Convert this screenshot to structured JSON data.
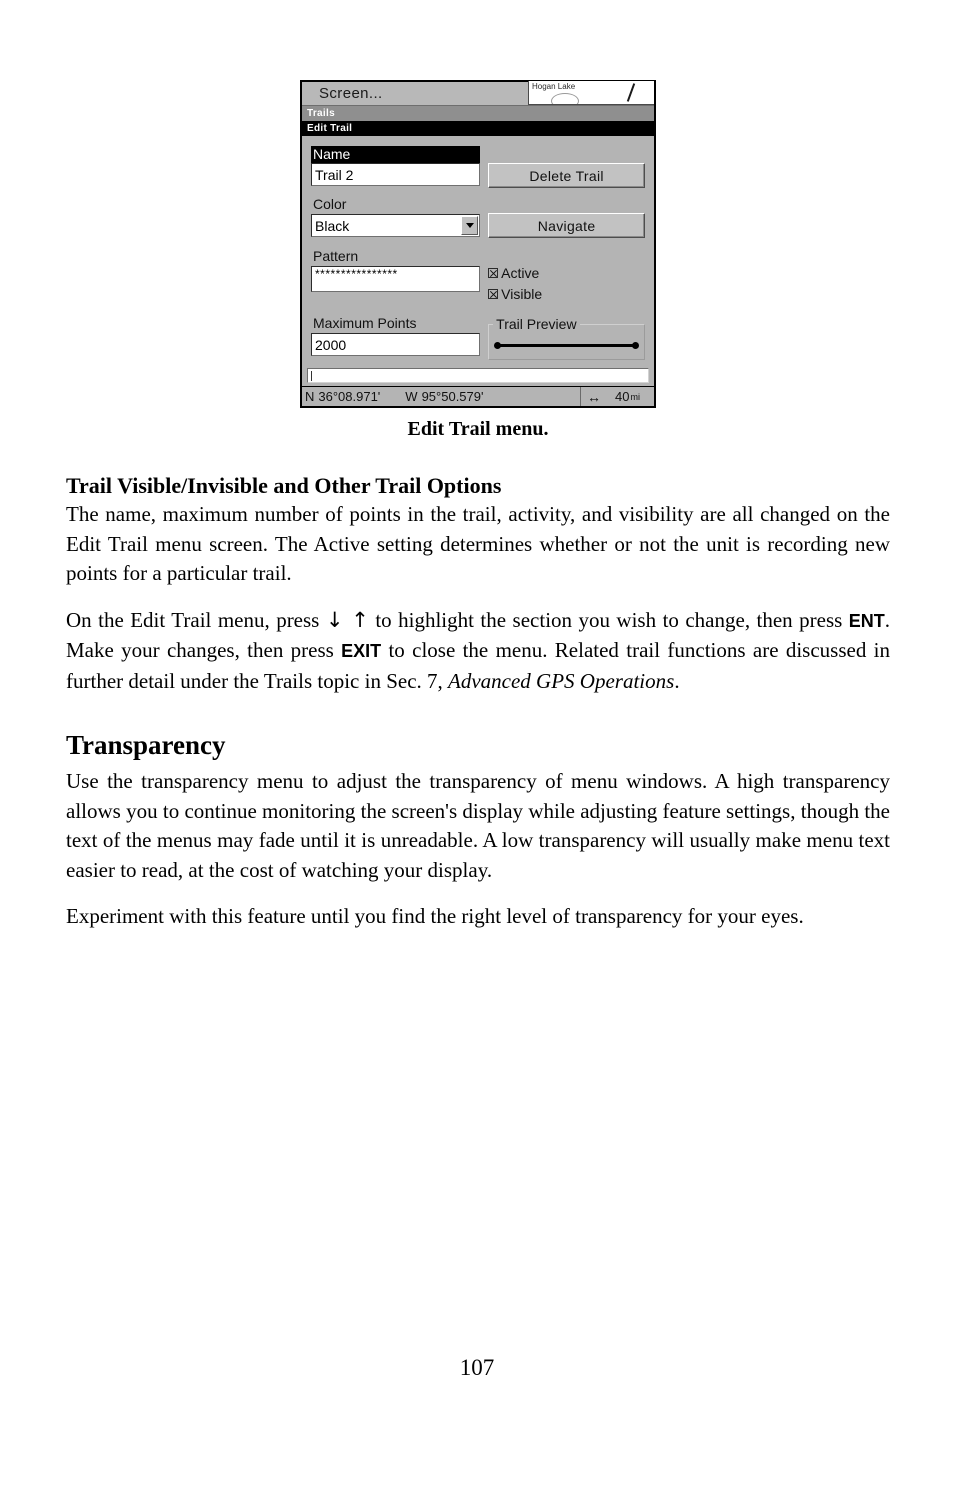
{
  "figure": {
    "caption": "Edit Trail menu.",
    "gps": {
      "screen_title": "Screen...",
      "map_label": "Hogan Lake",
      "menu_bar_gray": "Trails",
      "menu_bar_black": "Edit Trail",
      "name_label": "Name",
      "name_value": "Trail 2",
      "delete_button": "Delete Trail",
      "color_label": "Color",
      "color_value": "Black",
      "navigate_button": "Navigate",
      "pattern_label": "Pattern",
      "pattern_value": "****************",
      "active_label": "Active",
      "visible_label": "Visible",
      "max_points_label": "Maximum Points",
      "max_points_value": "2000",
      "trail_preview_label": "Trail Preview",
      "status": {
        "lat_hemi": "N",
        "lat_value": "36°08.971'",
        "lon_hemi": "W",
        "lon_value": "95°50.579'",
        "range_icon": "↔",
        "range_value": "40",
        "range_unit": "mi"
      }
    }
  },
  "sections": {
    "trail_options": {
      "heading": "Trail Visible/Invisible and Other Trail Options",
      "paragraph_1": "The name, maximum number of points in the trail, activity, and visibility are all changed on the Edit Trail menu screen. The Active setting determines whether or not the unit is recording new points for a particular trail.",
      "paragraph_2_part1": "On the Edit Trail menu, press ",
      "paragraph_2_arrows": "↓ ↑",
      "paragraph_2_part2": " to highlight the section you wish to change, then press ",
      "paragraph_2_key1": "ENT",
      "paragraph_2_part3": ". Make your changes, then press ",
      "paragraph_2_key2": "EXIT",
      "paragraph_2_part4": " to close the menu. Related trail functions are discussed in further detail under the Trails topic in Sec. 7, ",
      "paragraph_2_italic": "Advanced GPS Operations",
      "paragraph_2_part5": "."
    },
    "transparency": {
      "heading": "Transparency",
      "paragraph_1": "Use the transparency menu to adjust the transparency of menu windows. A high transparency allows you to continue monitoring the screen's display while adjusting feature settings, though the text of the menus may fade until it is unreadable. A low transparency will usually make menu text easier to read, at the cost of watching your display.",
      "paragraph_2": "Experiment with this feature until you find the right level of transparency for your eyes."
    }
  },
  "folio": "107"
}
